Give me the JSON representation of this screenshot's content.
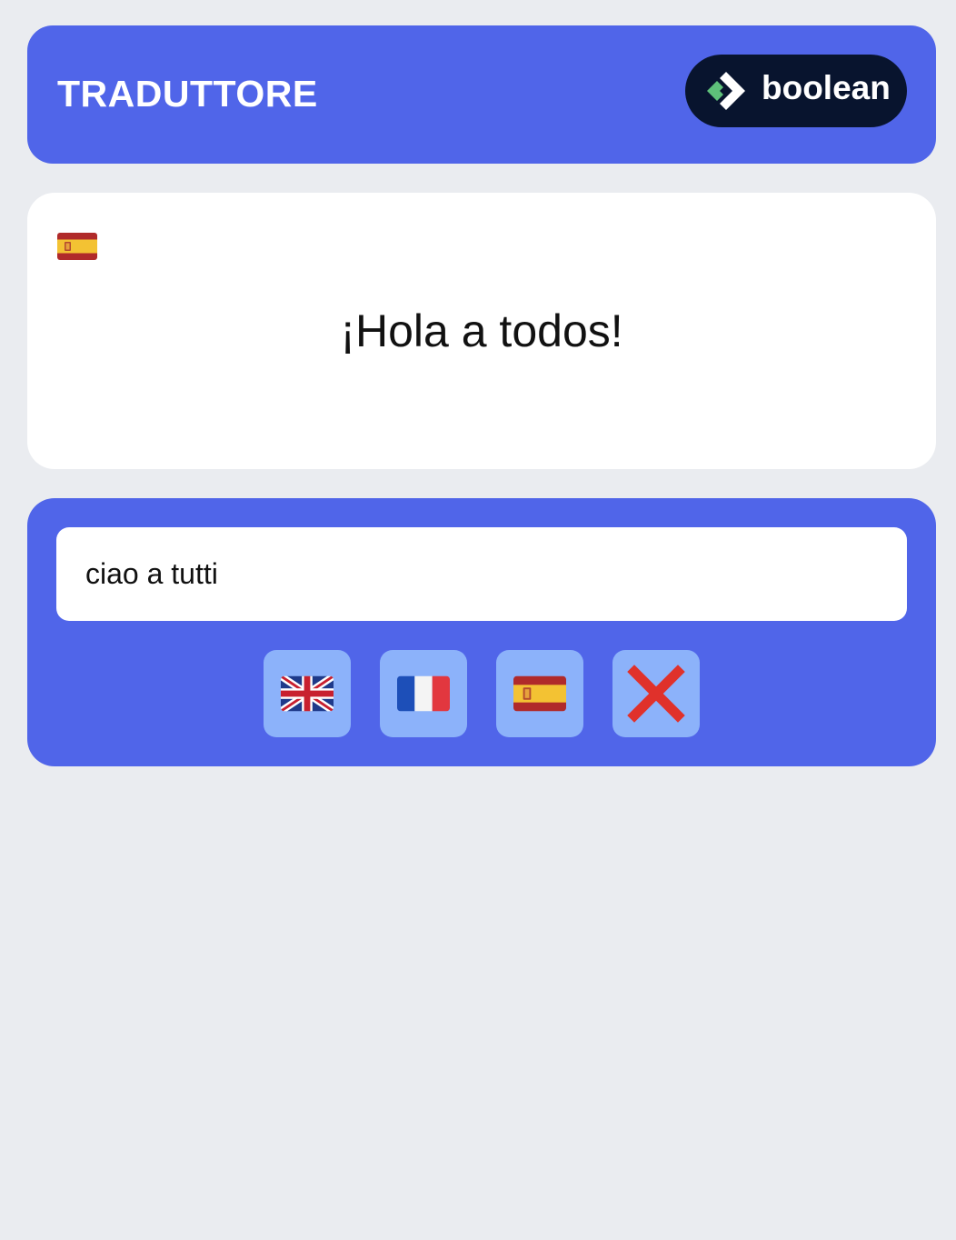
{
  "header": {
    "title": "TRADUTTORE",
    "brand_name": "boolean",
    "brand_logo_icon": "boolean-logo-icon"
  },
  "result": {
    "flag_icon": "spain-flag-icon",
    "translated_text": "¡Hola a todos!"
  },
  "input": {
    "value": "ciao a tutti",
    "placeholder": ""
  },
  "buttons": [
    {
      "name": "english-button",
      "icon": "uk-flag-icon"
    },
    {
      "name": "french-button",
      "icon": "france-flag-icon"
    },
    {
      "name": "spanish-button",
      "icon": "spain-flag-icon"
    },
    {
      "name": "clear-button",
      "icon": "cross-mark-icon"
    }
  ],
  "colors": {
    "background": "#eaecf0",
    "primary": "#5065e9",
    "button_bg": "#8cb2fa",
    "brand_pill": "#08142e",
    "brand_green": "#5ec07a"
  }
}
